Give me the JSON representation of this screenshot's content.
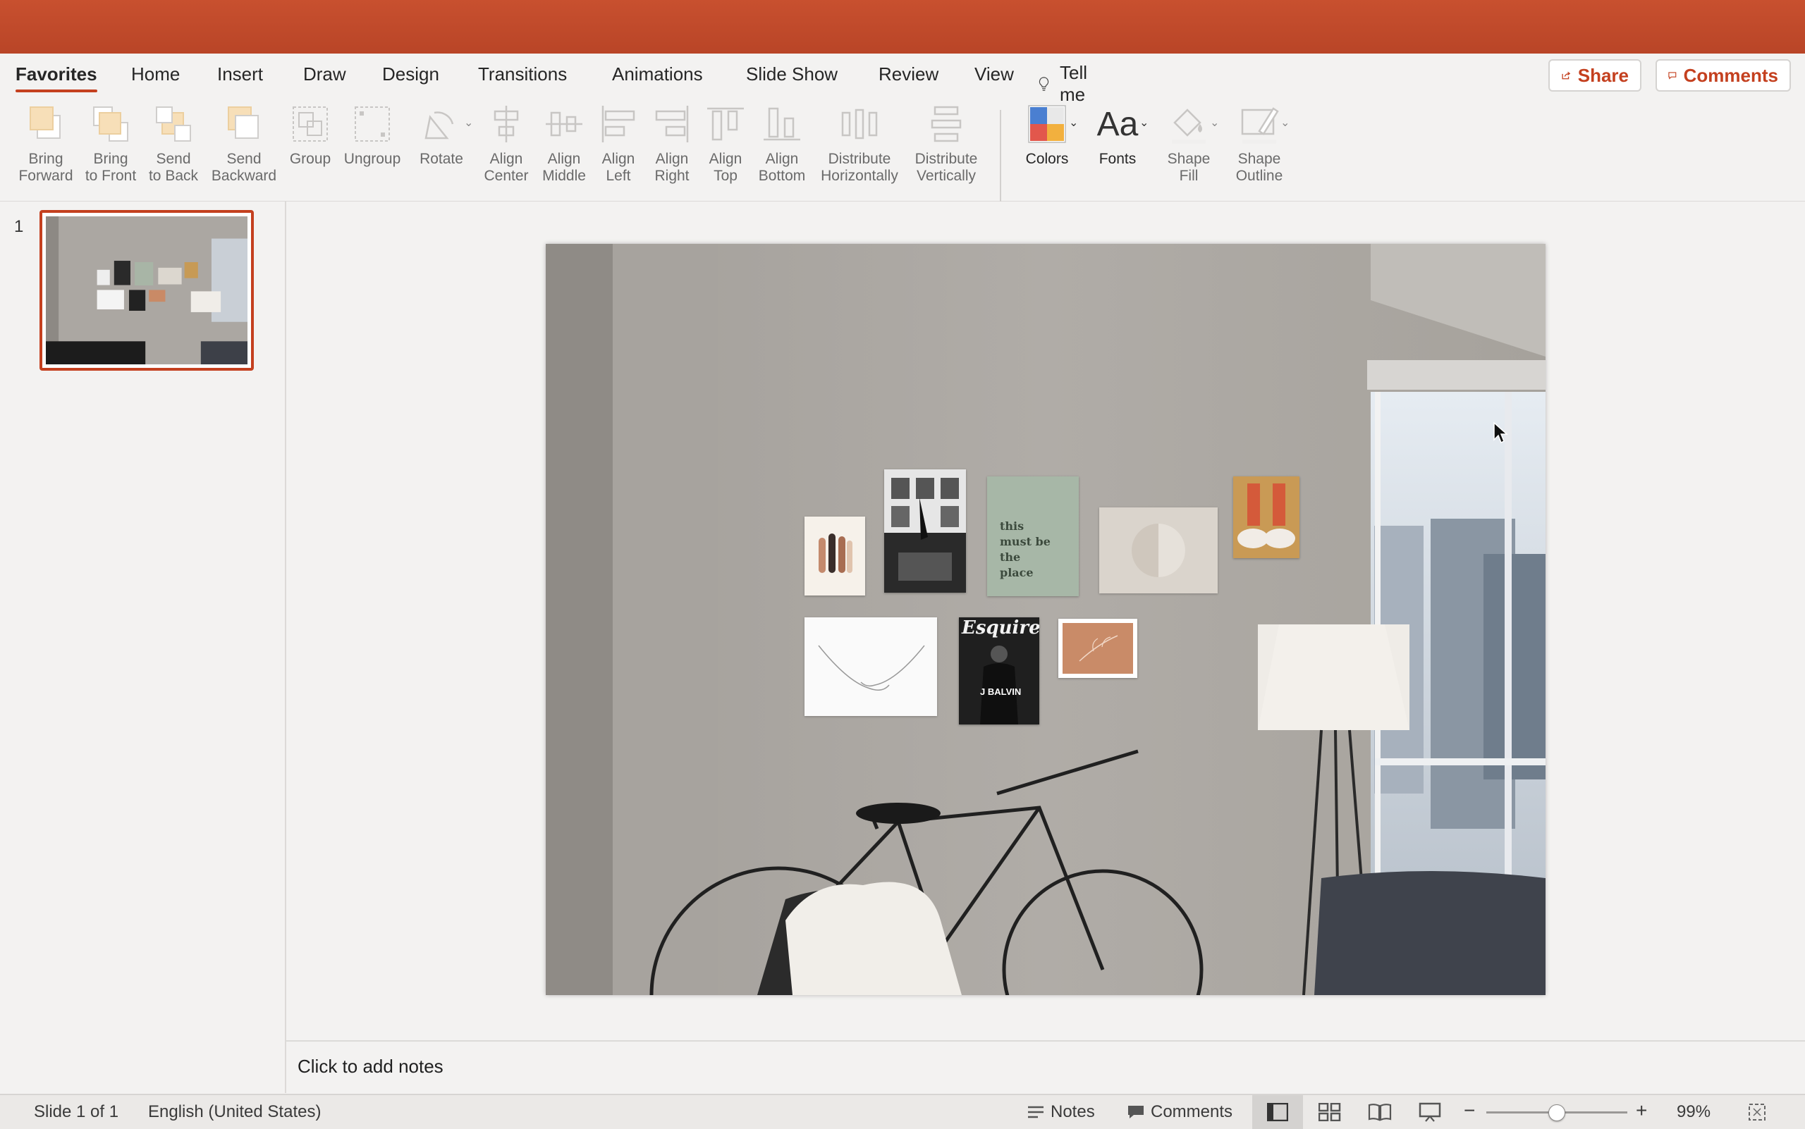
{
  "tabs": [
    "Favorites",
    "Home",
    "Insert",
    "Draw",
    "Design",
    "Transitions",
    "Animations",
    "Slide Show",
    "Review",
    "View"
  ],
  "tell_me": "Tell me",
  "share_label": "Share",
  "comments_label": "Comments",
  "tools": {
    "bring_forward": "Bring\nForward",
    "bring_to_front": "Bring\nto Front",
    "send_to_back": "Send\nto Back",
    "send_backward": "Send\nBackward",
    "group": "Group",
    "ungroup": "Ungroup",
    "rotate": "Rotate",
    "align_center": "Align\nCenter",
    "align_middle": "Align\nMiddle",
    "align_left": "Align\nLeft",
    "align_right": "Align\nRight",
    "align_top": "Align\nTop",
    "align_bottom": "Align\nBottom",
    "distribute_h": "Distribute\nHorizontally",
    "distribute_v": "Distribute\nVertically",
    "colors": "Colors",
    "fonts": "Fonts",
    "fonts_glyph": "Aa",
    "shape_fill": "Shape\nFill",
    "shape_outline": "Shape\nOutline"
  },
  "slide_number": "1",
  "slide_art": {
    "poster_text": "this\nmust be\nthe\nplace",
    "magazine_title": "Esquire",
    "magazine_subtitle": "J BALVIN"
  },
  "notes_placeholder": "Click to add notes",
  "status": {
    "slide_info": "Slide 1 of 1",
    "language": "English (United States)",
    "notes": "Notes",
    "comments": "Comments",
    "zoom_minus": "−",
    "zoom_plus": "+",
    "zoom": "99%"
  },
  "colors": {
    "accent": "#c4401f",
    "title_bar": "#c24c2c",
    "wall": "#aaa6a1"
  }
}
